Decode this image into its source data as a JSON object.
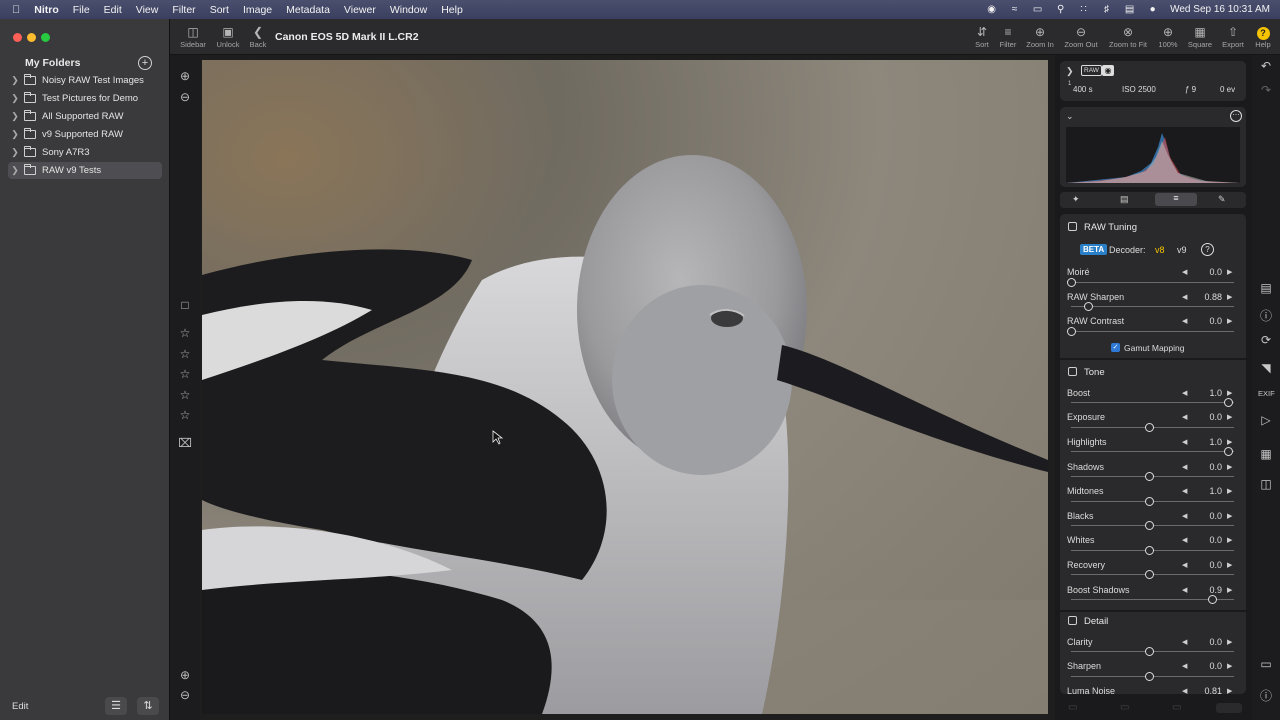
{
  "menubar": {
    "apple": "",
    "items": [
      "Nitro",
      "File",
      "Edit",
      "View",
      "Filter",
      "Sort",
      "Image",
      "Metadata",
      "Viewer",
      "Window",
      "Help"
    ],
    "clock": "Wed Sep 16  10:31 AM"
  },
  "sidebar": {
    "title": "My Folders",
    "add": "+",
    "folders": [
      {
        "label": "Noisy RAW Test Images"
      },
      {
        "label": "Test Pictures for Demo"
      },
      {
        "label": "All Supported RAW"
      },
      {
        "label": "v9 Supported RAW"
      },
      {
        "label": "Sony A7R3"
      },
      {
        "label": "RAW v9 Tests"
      }
    ],
    "edit": "Edit"
  },
  "toolbar": {
    "sidebar": "Sidebar",
    "unlock": "Unlock",
    "back": "Back",
    "title": "Canon EOS 5D Mark II L.CR2",
    "sort": "Sort",
    "filter": "Filter",
    "zoom_in": "Zoom In",
    "zoom_out": "Zoom Out",
    "zoom_fit": "Zoom to Fit",
    "zoom_100": "100%",
    "square": "Square",
    "export": "Export",
    "help": "Help",
    "help_glyph": "?"
  },
  "info": {
    "raw": "RAW",
    "shutter": "400 s",
    "shutter_num": "1",
    "iso": "ISO 2500",
    "aperture": "ƒ 9",
    "ev": "0 ev"
  },
  "raw_tuning": {
    "title": "RAW Tuning",
    "beta": "BETA",
    "decoder": "Decoder:",
    "v8": "v8",
    "v9": "v9",
    "help": "?",
    "gamut": "Gamut Mapping"
  },
  "sliders": {
    "moire": {
      "label": "Moiré",
      "value": "0.0"
    },
    "raw_sharpen": {
      "label": "RAW Sharpen",
      "value": "0.88"
    },
    "raw_contrast": {
      "label": "RAW Contrast",
      "value": "0.0"
    },
    "boost": {
      "label": "Boost",
      "value": "1.0"
    },
    "exposure": {
      "label": "Exposure",
      "value": "0.0"
    },
    "highlights": {
      "label": "Highlights",
      "value": "1.0"
    },
    "shadows": {
      "label": "Shadows",
      "value": "0.0"
    },
    "midtones": {
      "label": "Midtones",
      "value": "1.0"
    },
    "blacks": {
      "label": "Blacks",
      "value": "0.0"
    },
    "whites": {
      "label": "Whites",
      "value": "0.0"
    },
    "recovery": {
      "label": "Recovery",
      "value": "0.0"
    },
    "boost_shadows": {
      "label": "Boost Shadows",
      "value": "0.9"
    },
    "clarity": {
      "label": "Clarity",
      "value": "0.0"
    },
    "sharpen": {
      "label": "Sharpen",
      "value": "0.0"
    },
    "luma_noise": {
      "label": "Luma Noise",
      "value": "0.81"
    }
  },
  "sections": {
    "tone": "Tone",
    "detail": "Detail"
  },
  "strip": {
    "exif": "EXIF"
  },
  "colors": {
    "accent_yellow": "#f5c400",
    "accent_blue": "#2e7ad6",
    "beta_bg": "#2a7fc9"
  }
}
